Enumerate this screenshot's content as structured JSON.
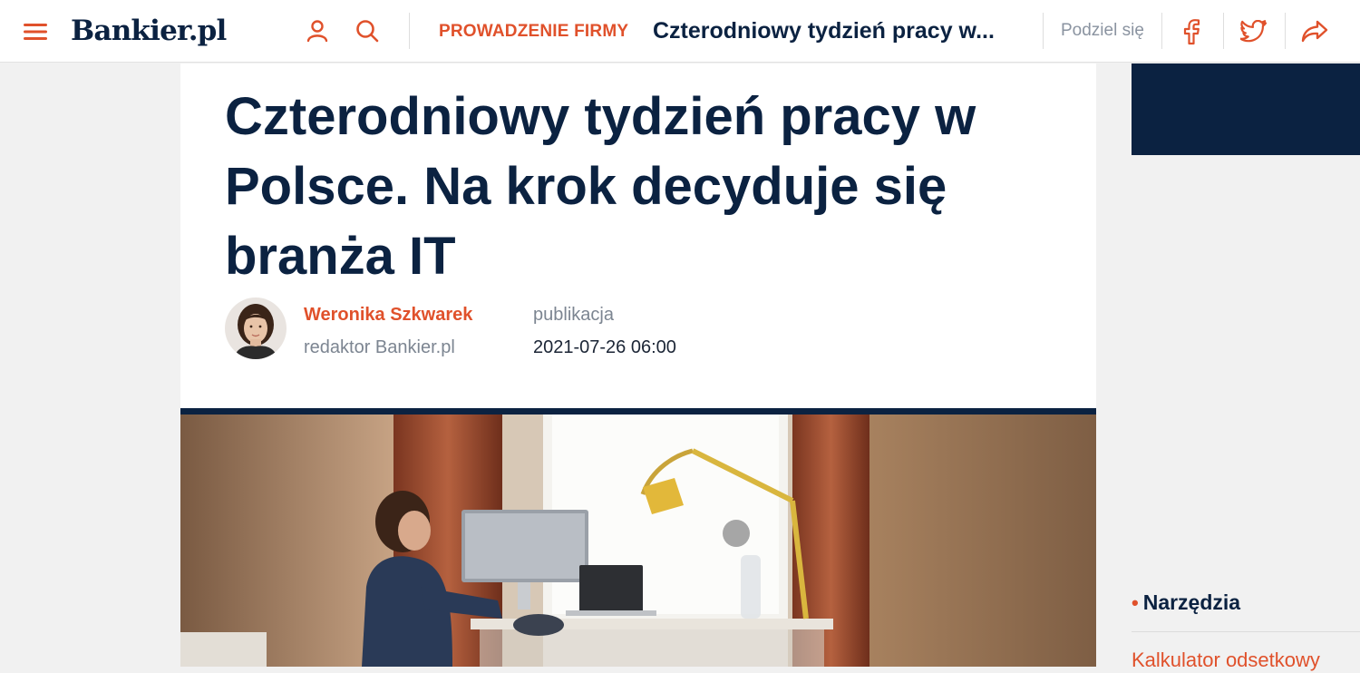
{
  "header": {
    "logo": "Bankier.pl",
    "section": "PROWADZENIE FIRMY",
    "title": "Czterodniowy tydzień pracy w...",
    "share_label": "Podziel się"
  },
  "article": {
    "headline": "Czterodniowy tydzień pracy w Polsce. Na krok decyduje się branża IT",
    "author": {
      "name": "Weronika Szkwarek",
      "role": "redaktor Bankier.pl"
    },
    "published": {
      "label": "publikacja",
      "date": "2021-07-26 06:00"
    }
  },
  "sidebar": {
    "tools_heading": "Narzędzia",
    "tools_link": "Kalkulator odsetkowy"
  },
  "colors": {
    "brand_navy": "#0b2241",
    "accent_orange": "#e0512b",
    "muted_text": "#7c8591"
  }
}
